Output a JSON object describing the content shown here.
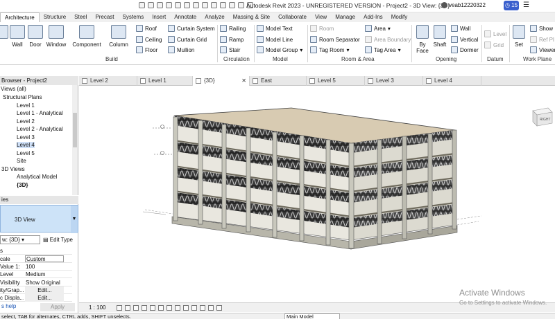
{
  "window": {
    "title": "Autodesk Revit 2023 - UNREGISTERED VERSION - Project2 - 3D View: {3D}",
    "user": "veab12220322",
    "notifications": "15"
  },
  "tabs": [
    "Architecture",
    "Structure",
    "Steel",
    "Precast",
    "Systems",
    "Insert",
    "Annotate",
    "Analyze",
    "Massing & Site",
    "Collaborate",
    "View",
    "Manage",
    "Add-Ins",
    "Modify"
  ],
  "ribbon": {
    "build": {
      "wall": "Wall",
      "door": "Door",
      "window": "Window",
      "component": "Component",
      "column": "Column",
      "roof": "Roof",
      "ceiling": "Ceiling",
      "floor": "Floor",
      "curtain_system": "Curtain System",
      "curtain_grid": "Curtain Grid",
      "mullion": "Mullion",
      "label": "Build"
    },
    "circulation": {
      "railing": "Railing",
      "ramp": "Ramp",
      "stair": "Stair",
      "label": "Circulation"
    },
    "model": {
      "text": "Model Text",
      "line": "Model Line",
      "group": "Model Group",
      "label": "Model"
    },
    "room_area": {
      "room": "Room",
      "room_separator": "Room Separator",
      "tag_room": "Tag Room",
      "area": "Area",
      "area_boundary": "Area Boundary",
      "tag_area": "Tag Area",
      "label": "Room & Area"
    },
    "opening": {
      "by_face": "By Face",
      "by_face_l1": "By",
      "by_face_l2": "Face",
      "shaft": "Shaft",
      "wall": "Wall",
      "vertical": "Vertical",
      "dormer": "Dormer",
      "label": "Opening"
    },
    "datum": {
      "level": "Level",
      "grid": "Grid",
      "label": "Datum"
    },
    "work_plane": {
      "set": "Set",
      "show": "Show",
      "ref_plane": "Ref Pl",
      "viewer": "Viewer",
      "label": "Work Plane"
    }
  },
  "view_tabs": [
    {
      "label": "Level 2",
      "active": false
    },
    {
      "label": "Level 1",
      "active": false
    },
    {
      "label": "{3D}",
      "active": true
    },
    {
      "label": "East",
      "active": false
    },
    {
      "label": "Level 5",
      "active": false
    },
    {
      "label": "Level 3",
      "active": false
    },
    {
      "label": "Level 4",
      "active": false
    }
  ],
  "browser": {
    "title": "Browser - Project2",
    "items": [
      "Views (all)",
      "Structural Plans",
      "Level 1",
      "Level 1 - Analytical",
      "Level 2",
      "Level 2 - Analytical",
      "Level 3",
      "Level 4",
      "Level 5",
      "Site",
      "3D Views",
      "Analytical Model",
      "{3D}"
    ]
  },
  "properties": {
    "title": "ies",
    "type": "3D View",
    "view_selector": "w: {3D}",
    "edit_type": "Edit Type",
    "section": "s",
    "rows": [
      {
        "key": "cale",
        "value": "Custom"
      },
      {
        "key": "Value   1:",
        "value": "100"
      },
      {
        "key": "Level",
        "value": "Medium"
      },
      {
        "key": "Visibility",
        "value": "Show Original"
      },
      {
        "key": "ity/Grap...",
        "value": "Edit..."
      },
      {
        "key": "c Displa...",
        "value": "Edit..."
      }
    ],
    "help": "s help",
    "apply": "Apply"
  },
  "view_control": {
    "scale": "1 : 100"
  },
  "status": {
    "text": "select, TAB for alternates, CTRL adds, SHIFT unselects.",
    "model": "Main Model"
  },
  "watermark": {
    "line1": "Activate Windows",
    "line2": "Go to Settings to activate Windows."
  },
  "viewcube": {
    "face": "RIGHT"
  }
}
